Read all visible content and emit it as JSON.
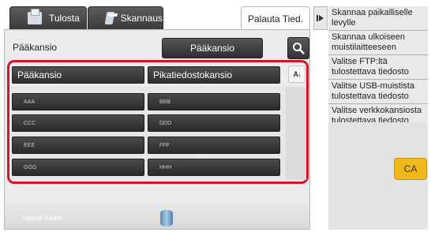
{
  "tabs": {
    "print": "Tulosta",
    "scan": "Skannaus",
    "back": "Palauta Tied."
  },
  "folder": {
    "label": "Pääkansio",
    "button": "Pääkansio",
    "search_icon": "search-icon"
  },
  "list": {
    "header_main": "Pääkansio",
    "header_quick": "Pikatiedostokansio",
    "sort_label": "A↓",
    "items": [
      "AAA",
      "BBB",
      "CCC",
      "DDD",
      "EEE",
      "FFF",
      "GGG",
      "HHH"
    ]
  },
  "footer": {
    "select_all": "Valitse kaikki"
  },
  "side_menu": [
    "Skannaa paikalliselle levylle",
    "Skannaa ulkoiseen muistilaitteeseen",
    "Valitse FTP:ltä tulostettava tiedosto",
    "Valitse USB-muistista tulostettava tiedosto",
    "Valitse verkkokansiosta tulostettava tiedosto"
  ],
  "ca_button": "CA",
  "colors": {
    "highlight": "#d0182a",
    "ca": "#f0b81b"
  }
}
